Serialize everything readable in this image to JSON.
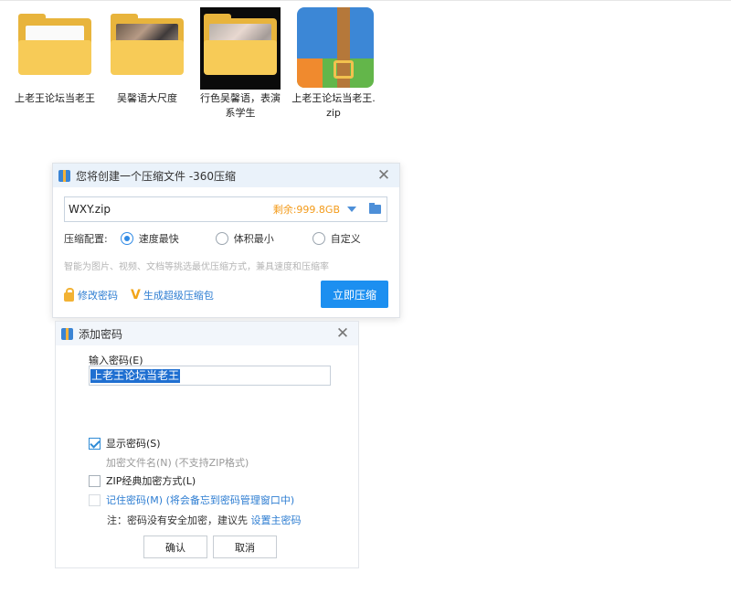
{
  "desktop": {
    "icons": [
      {
        "label": "上老王论坛当老王",
        "icon": "folder-icon"
      },
      {
        "label": "吴馨语大尺度",
        "icon": "folder-icon"
      },
      {
        "label": "行色吴馨语，表演系学生",
        "icon": "folder-icon"
      },
      {
        "label": "上老王论坛当老王.zip",
        "icon": "zip-archive-icon",
        "badge": "360 ZIP"
      }
    ]
  },
  "compress_dialog": {
    "title": "您将创建一个压缩文件 -360压缩",
    "close": "✕",
    "filename": "WXY.zip",
    "remaining": "剩余:999.8GB",
    "config_label": "压缩配置:",
    "options": [
      "速度最快",
      "体积最小",
      "自定义"
    ],
    "selected_option": "速度最快",
    "hint": "智能为图片、视频、文档等挑选最优压缩方式，兼具速度和压缩率",
    "change_password": "修改密码",
    "super_pack": "生成超级压缩包",
    "compress_now": "立即压缩"
  },
  "password_dialog": {
    "title": "添加密码",
    "close": "✕",
    "input_label": "输入密码(E)",
    "password_value": "上老王论坛当老王",
    "show_password": "显示密码(S)",
    "encrypt_filename": "加密文件名(N) (不支持ZIP格式)",
    "zip_classic": "ZIP经典加密方式(L)",
    "remember_password": "记住密码(M) (将会备忘到密码管理窗口中)",
    "note_prefix": "注：密码没有安全加密，建议先",
    "note_link": "设置主密码",
    "ok": "确认",
    "cancel": "取消"
  },
  "colors": {
    "accent": "#1c8ff0",
    "remaining": "#f39b1a",
    "link": "#2d7dd2"
  }
}
